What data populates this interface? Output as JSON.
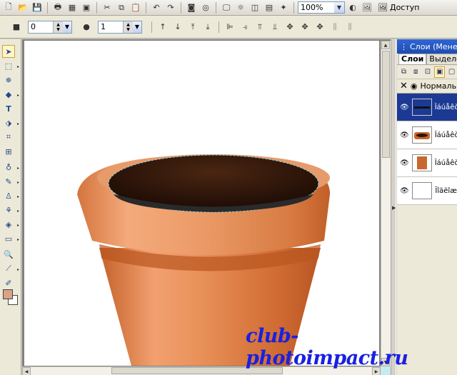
{
  "toolbar": {
    "zoom_value": "100%",
    "access_label": "Доступ"
  },
  "attribute_bar": {
    "width_value": "0",
    "height_value": "1"
  },
  "layers_panel": {
    "title": "Слои (Менеджер",
    "tabs": [
      {
        "label": "Слои"
      },
      {
        "label": "Выделен"
      }
    ],
    "blend_mode": "Нормальн",
    "layers": [
      {
        "name": "Îáúåêò"
      },
      {
        "name": "Îáúåêò"
      },
      {
        "name": "Îáúåêò"
      },
      {
        "name": "Ïîäëîæ"
      }
    ]
  },
  "watermark": "club-photoimpact.ru"
}
